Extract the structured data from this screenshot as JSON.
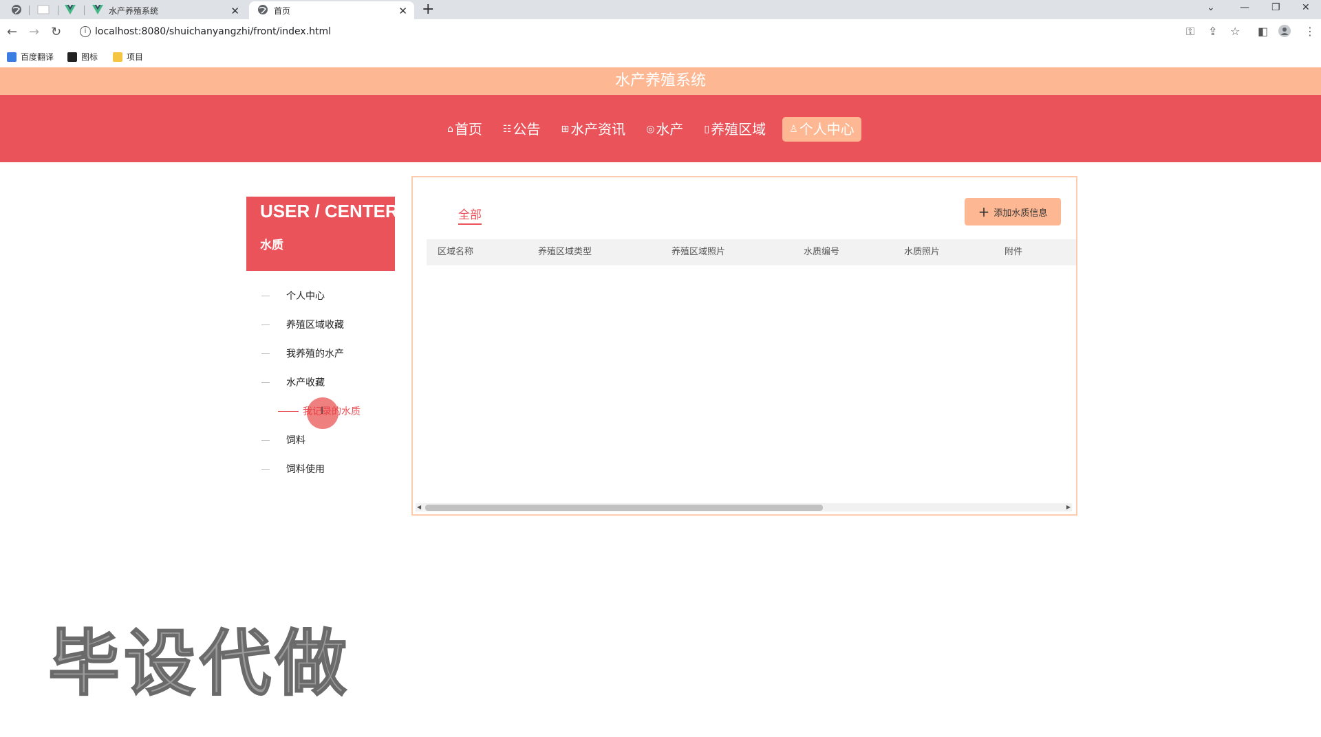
{
  "browser": {
    "tabs": [
      {
        "title": "水产养殖系统",
        "icon": "vue-icon"
      },
      {
        "title": "首页",
        "icon": "globe-icon",
        "active": true
      }
    ],
    "url": "localhost:8080/shuichanyangzhi/front/index.html",
    "bookmarks": [
      "百度翻译",
      "图标",
      "项目"
    ]
  },
  "site": {
    "title": "水产养殖系统",
    "nav": [
      {
        "icon": "⌂",
        "label": "首页"
      },
      {
        "icon": "☷",
        "label": "公告"
      },
      {
        "icon": "⊞",
        "label": "水产资讯"
      },
      {
        "icon": "◎",
        "label": "水产"
      },
      {
        "icon": "▯",
        "label": "养殖区域"
      },
      {
        "icon": "♙",
        "label": "个人中心",
        "active": true
      }
    ]
  },
  "user_center": {
    "title": "USER / CENTER",
    "subtitle": "水质",
    "menu": [
      "个人中心",
      "养殖区域收藏",
      "我养殖的水产",
      "水产收藏",
      "我记录的水质",
      "饲料",
      "饲料使用"
    ],
    "active_index": 4
  },
  "panel": {
    "tab_all": "全部",
    "add_button": "添加水质信息",
    "columns": [
      "区域名称",
      "养殖区域类型",
      "养殖区域照片",
      "水质编号",
      "水质照片",
      "附件"
    ]
  },
  "watermark": "毕设代做",
  "colors": {
    "accent": "#ea5359",
    "accent_light": "#fdb893"
  }
}
